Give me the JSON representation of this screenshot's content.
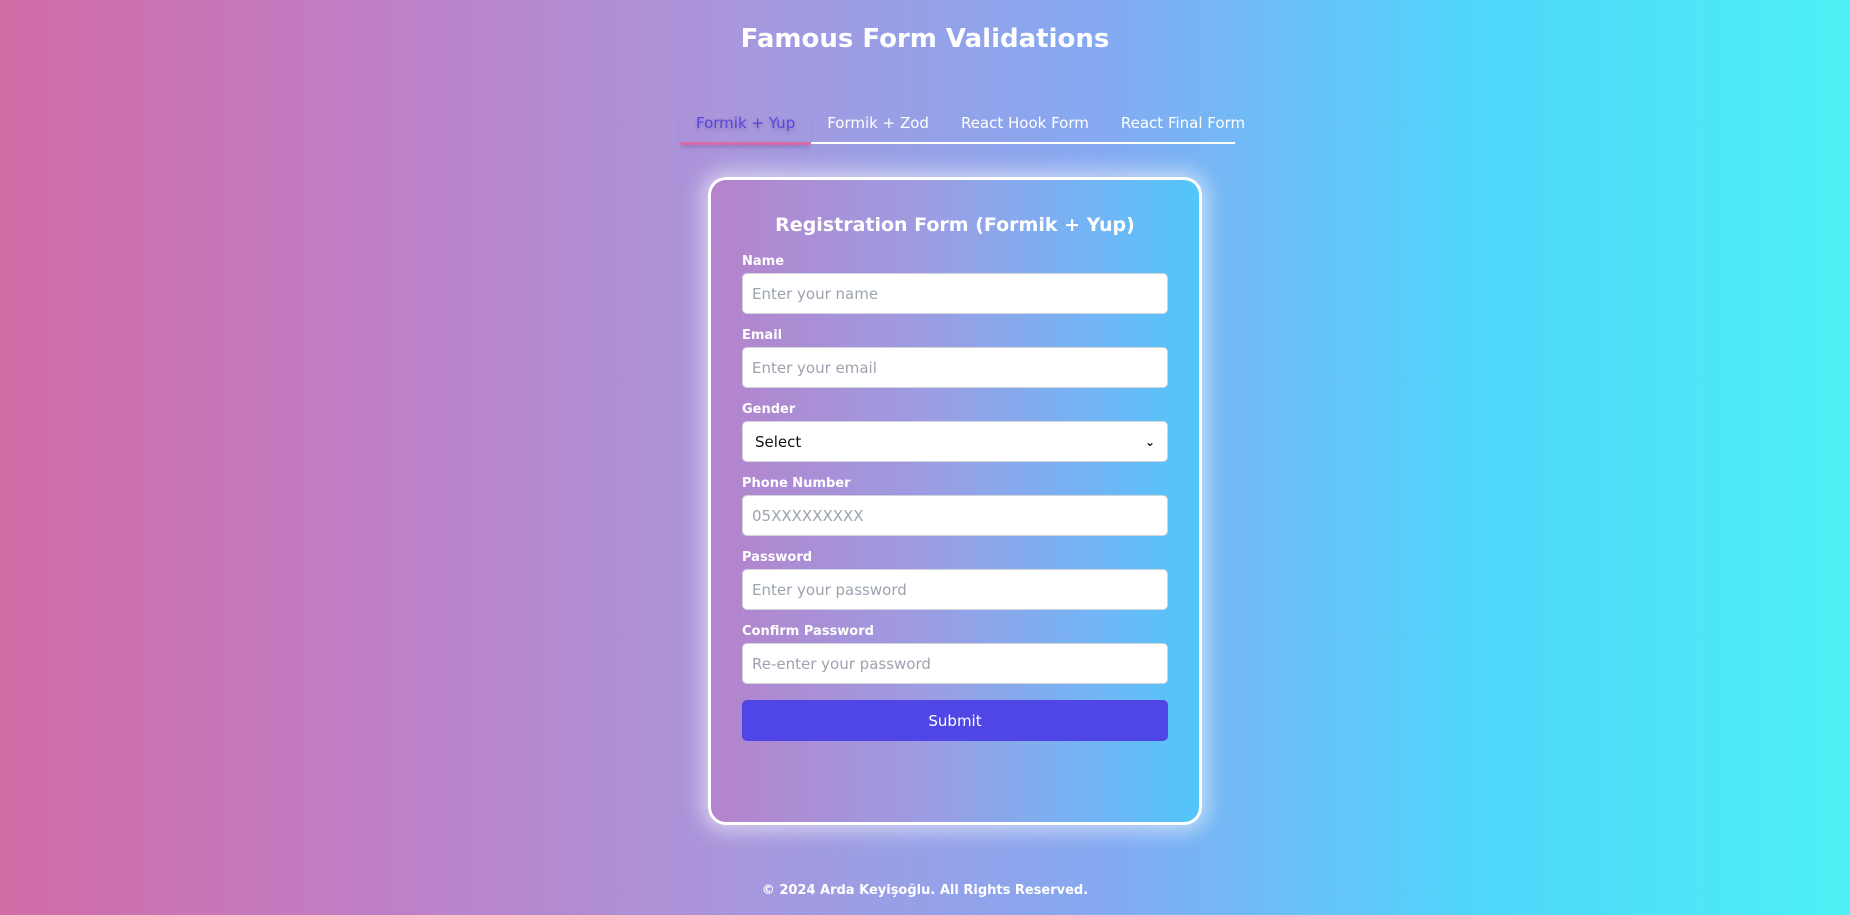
{
  "header": {
    "title": "Famous Form Validations"
  },
  "tabs": [
    {
      "label": "Formik + Yup",
      "active": true
    },
    {
      "label": "Formik + Zod",
      "active": false
    },
    {
      "label": "React Hook Form",
      "active": false
    },
    {
      "label": "React Final Form",
      "active": false
    }
  ],
  "form": {
    "title": "Registration Form (Formik + Yup)",
    "fields": {
      "name": {
        "label": "Name",
        "placeholder": "Enter your name",
        "value": ""
      },
      "email": {
        "label": "Email",
        "placeholder": "Enter your email",
        "value": ""
      },
      "gender": {
        "label": "Gender",
        "selected": "Select"
      },
      "phone": {
        "label": "Phone Number",
        "placeholder": "05XXXXXXXXX",
        "value": ""
      },
      "password": {
        "label": "Password",
        "placeholder": "Enter your password",
        "value": ""
      },
      "confirm_password": {
        "label": "Confirm Password",
        "placeholder": "Re-enter your password",
        "value": ""
      }
    },
    "submit_label": "Submit"
  },
  "footer": {
    "text": "© 2024 Arda Keyişoğlu. All Rights Reserved."
  },
  "colors": {
    "accent": "#4f46e5",
    "active_tab_text": "#5b43e0",
    "active_tab_underline": "#d86aa8"
  }
}
